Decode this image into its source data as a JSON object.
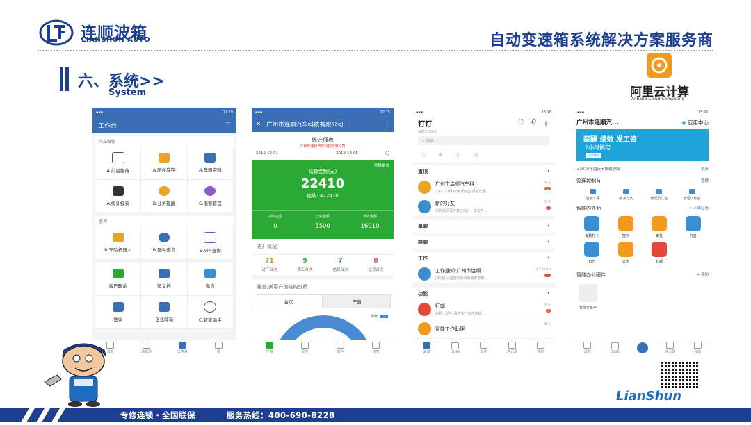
{
  "header": {
    "brand_cn": "连顺波箱",
    "brand_en": "LIANSHUN AUTO",
    "slogan": "自动变速箱系统解决方案服务商"
  },
  "section": {
    "title": "六、系统>>",
    "subtitle": "System"
  },
  "partner": {
    "name_cn": "阿里云计算",
    "name_en": "Alibaba Cloud Computing"
  },
  "phone1": {
    "time": "12:19",
    "title": "工作台",
    "group1_label": "汽车维修",
    "group1": [
      "A.前台接待",
      "A.配件库存",
      "A.车辆资料",
      "A.统计报表",
      "B.业务提醒",
      "C.潜客管理"
    ],
    "group2_label": "查询",
    "group2": [
      "B.车险机器人",
      "B.配件查询",
      "B.VIN查询"
    ],
    "group3": [
      "客户联系",
      "微文档",
      "微盘",
      "会议",
      "企业邮箱",
      "C.管家助手"
    ],
    "tabs": [
      "消息",
      "通讯录",
      "工作台",
      "我"
    ]
  },
  "phone2": {
    "time": "12:15",
    "title": "广州市连顺汽车科技有限公司...",
    "report_title": "统计报表",
    "company": "广州市连顺汽车科技有限公司",
    "date_from": "2019-12-01",
    "date_to": "2019-12-05",
    "unit_toggle": "切换单位",
    "settle_label": "结算金额(元)",
    "settle_total": "22410",
    "receivable": "应收: ¥22410",
    "stats": [
      {
        "label": "减收金额",
        "value": "0"
      },
      {
        "label": "已收金额",
        "value": "5500"
      },
      {
        "label": "未收金额",
        "value": "16910"
      }
    ],
    "progress_title": "进厂情况",
    "progress": [
      {
        "value": "71",
        "label": "进厂台次",
        "color": "#e28a1c"
      },
      {
        "value": "9",
        "label": "完工台次",
        "color": "#2aa935"
      },
      {
        "value": "7",
        "label": "结算台次",
        "color": "#2aa935"
      },
      {
        "value": "0",
        "label": "返修台次",
        "color": "#e5473b"
      }
    ],
    "analysis_title": "维修/美容产值结构分析",
    "seg": [
      "台次",
      "产值"
    ],
    "legend": "维修",
    "tabs": [
      "产值",
      "配件",
      "客户",
      "财务"
    ]
  },
  "phone3": {
    "time": "13:26",
    "title": "钉钉",
    "sub": "设置工作状态",
    "search": "搜索",
    "sec_top": "置顶",
    "items": [
      {
        "title": "广州市连顺汽车科...",
        "text": "小钉: 12月4日的群运营报告已更...",
        "time": "昨天",
        "badge": "20"
      },
      {
        "title": "新的好友",
        "text": "你的通讯录好友已加入，快去打...",
        "time": "昨天",
        "badge": "2"
      }
    ],
    "sec_single": "单聊",
    "sec_group": "群聊",
    "sec_work": "工作",
    "work_item": {
      "title": "工作通知:广州市连顺...",
      "text": "[审批] 小昌提交的请假需要您审...",
      "time": "上午10:15",
      "badge": "33"
    },
    "sec_func": "功能",
    "func_item": {
      "title": "钉邮",
      "text": "考勤小助手:请查收广州市连顺...",
      "time": "昨天",
      "badge": "1"
    },
    "func_item2": {
      "title": "智能工作助理",
      "time": "昨天"
    },
    "tabs": [
      "消息",
      "DING",
      "工作",
      "通讯录",
      "我的"
    ]
  },
  "phone4": {
    "time": "13:24",
    "org": "广州市连顺汽...",
    "app_center": "应用中心",
    "banner_l1": "薪酬 绩效 发工资",
    "banner_l2": "2小时搞定",
    "banner_btn": "立即体验",
    "notice": "2019年国庆节放假通知",
    "more": "更多",
    "ctl_title": "管理控制台",
    "ctl_link": "管理",
    "ctl": [
      "智能人事",
      "解决方案",
      "管理员认证",
      "管理工作台"
    ],
    "app_title": "智能内外勤",
    "app_link": "+ 人事应用",
    "apps": [
      {
        "label": "考勤打卡",
        "color": "#3b8fd0"
      },
      {
        "label": "签到",
        "color": "#f39a1e"
      },
      {
        "label": "审批",
        "color": "#f39a1e"
      },
      {
        "label": "钉盘",
        "color": "#3b8fd0"
      },
      {
        "label": "日志",
        "color": "#3b8fd0"
      },
      {
        "label": "公告",
        "color": "#f39a1e"
      },
      {
        "label": "钉邮",
        "color": "#e5473b"
      }
    ],
    "hw_title": "智能办公硬件",
    "hw_link": "+ 添加",
    "hw_item": "智能云签章",
    "tabs": [
      "消息",
      "DING",
      "",
      "通讯录",
      "我的"
    ]
  },
  "footer": {
    "text": "专修连锁・全国联保",
    "hotline": "服务热线：400-690-8228",
    "brand": "LianShun"
  }
}
